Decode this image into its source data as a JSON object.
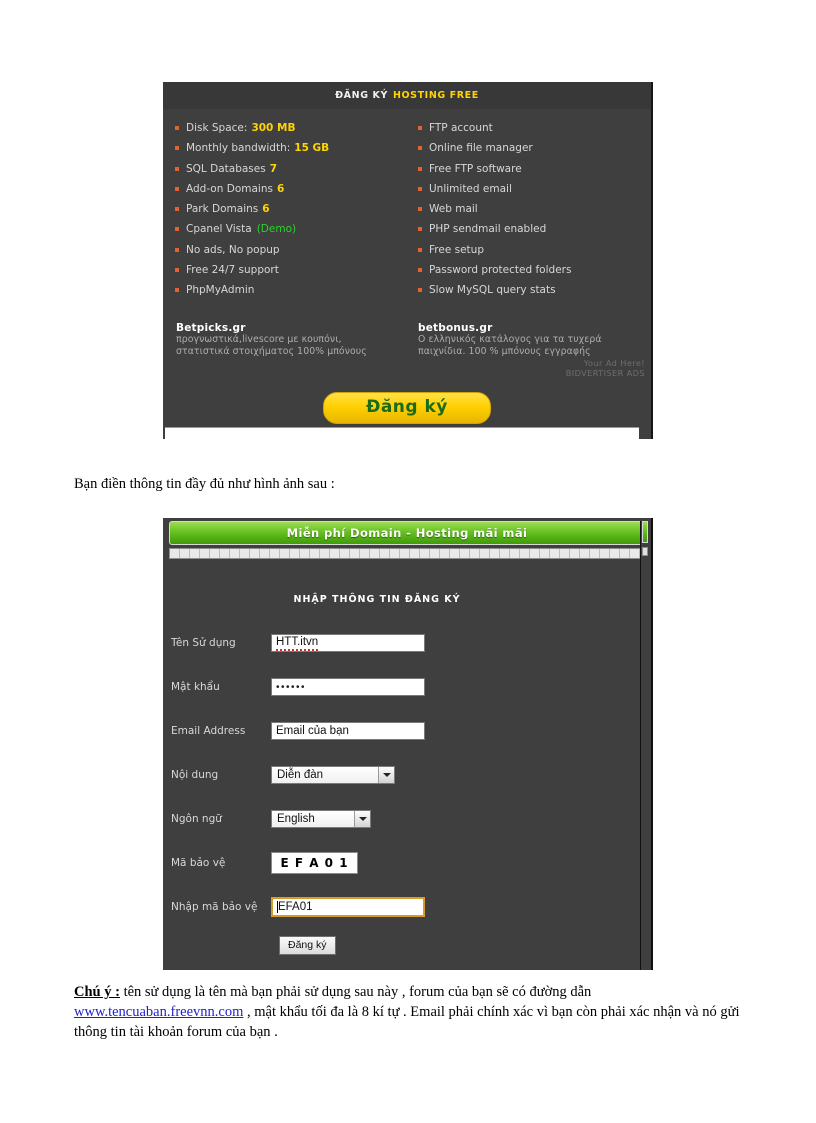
{
  "document": {
    "caption_before_form": "Bạn điền thông tin đầy đủ như hình ảnh sau :",
    "note": {
      "label": "Chú ý :",
      "text_part1": " tên sử dụng là tên mà bạn phải sử dụng sau này , forum của bạn sẽ có đường dẫn",
      "link": "www.tencuaban.freevnn.com",
      "text_part2": " , mật khẩu tối đa là 8 kí tự . Email phải chính xác vì bạn còn phải xác nhận và nó gửi thông tin tài khoản forum của bạn ."
    }
  },
  "banner": {
    "title_plain": "ĐĂNG KÝ",
    "title_highlight": "HOSTING FREE",
    "features_left": [
      {
        "text": "Disk Space:",
        "value": "300 MB"
      },
      {
        "text": "Monthly bandwidth:",
        "value": "15 GB"
      },
      {
        "text": "SQL Databases",
        "value": "7"
      },
      {
        "text": "Add-on Domains",
        "value": "6"
      },
      {
        "text": "Park Domains",
        "value": "6"
      },
      {
        "text": "Cpanel Vista",
        "value": "",
        "demo": "(Demo)"
      },
      {
        "text": "No ads, No popup",
        "value": ""
      },
      {
        "text": "Free 24/7 support",
        "value": ""
      },
      {
        "text": "PhpMyAdmin",
        "value": ""
      }
    ],
    "features_right": [
      {
        "text": "FTP account"
      },
      {
        "text": "Online file manager"
      },
      {
        "text": "Free FTP software"
      },
      {
        "text": "Unlimited email"
      },
      {
        "text": "Web mail"
      },
      {
        "text": "PHP sendmail enabled"
      },
      {
        "text": "Free setup"
      },
      {
        "text": "Password protected folders"
      },
      {
        "text": "Slow MySQL query stats"
      }
    ],
    "ads": [
      {
        "title": "Betpicks.gr",
        "line1": "προγνωστικά,livescore με κουπόνι,",
        "line2": "στατιστικά στοιχήματος 100% μπόνους"
      },
      {
        "title": "betbonus.gr",
        "line1": "Ο ελληνικός κατάλογος για τα τυχερά",
        "line2": "παιχνίδια. 100 % μπόνους εγγραφής"
      }
    ],
    "ad_here_line1": "Your Ad Here!",
    "ad_here_line2": "BIDVERTISER ADS",
    "cta_label": "Đăng ký",
    "colors": {
      "background": "#3f3f3f",
      "title_highlight": "#ffd400",
      "bullet": "#e0642c",
      "demo_link": "#2ad32a",
      "cta_fill": "#ffd000",
      "cta_text": "#1a6b1a"
    }
  },
  "form_screenshot": {
    "header_title": "Miễn phí Domain - Hosting mãi mãi",
    "section_heading": "NHẬP THÔNG TIN ĐĂNG KÝ",
    "fields": [
      {
        "label": "Tên Sử dụng",
        "value": "HTT.itvn",
        "type": "text"
      },
      {
        "label": "Mật khẩu",
        "value": "••••••",
        "type": "password"
      },
      {
        "label": "Email Address",
        "value": "Email của bạn",
        "type": "text"
      },
      {
        "label": "Nội dung",
        "value": "Diễn đàn",
        "type": "select"
      },
      {
        "label": "Ngôn ngữ",
        "value": "English",
        "type": "select"
      },
      {
        "label": "Mã bảo vệ",
        "value": "E F A 0 1",
        "type": "captcha"
      },
      {
        "label": "Nhập mã bảo vệ",
        "value": "EFA01",
        "type": "text-focused"
      }
    ],
    "submit_label": "Đăng ký",
    "colors": {
      "background": "#3f3f3f",
      "header_green": "#64bf20",
      "focused_border": "#d79b2a"
    }
  }
}
